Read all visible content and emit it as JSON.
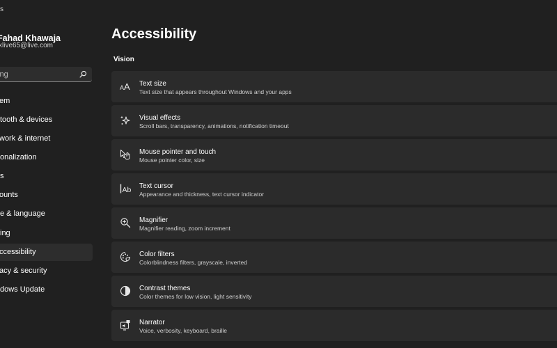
{
  "window": {
    "title_fragment": "s"
  },
  "profile": {
    "name": "Fahad Khawaja",
    "email": "xlive65@live.com"
  },
  "search": {
    "value": "ting"
  },
  "sidebar": {
    "items": [
      {
        "label": "em"
      },
      {
        "label": "tooth & devices"
      },
      {
        "label": "work & internet"
      },
      {
        "label": "onalization"
      },
      {
        "label": "s"
      },
      {
        "label": "ounts"
      },
      {
        "label": "e & language"
      },
      {
        "label": "ing"
      },
      {
        "label": "ccessibility",
        "selected": true
      },
      {
        "label": "acy & security"
      },
      {
        "label": "dows Update"
      }
    ]
  },
  "main": {
    "title": "Accessibility",
    "section": "Vision",
    "cards": [
      {
        "title": "Text size",
        "desc": "Text size that appears throughout Windows and your apps",
        "icon": "text-size-icon"
      },
      {
        "title": "Visual effects",
        "desc": "Scroll bars, transparency, animations, notification timeout",
        "icon": "sparkle-icon"
      },
      {
        "title": "Mouse pointer and touch",
        "desc": "Mouse pointer color, size",
        "icon": "mouse-pointer-icon"
      },
      {
        "title": "Text cursor",
        "desc": "Appearance and thickness, text cursor indicator",
        "icon": "text-cursor-icon"
      },
      {
        "title": "Magnifier",
        "desc": "Magnifier reading, zoom increment",
        "icon": "magnifier-icon"
      },
      {
        "title": "Color filters",
        "desc": "Colorblindness filters, grayscale, inverted",
        "icon": "color-filters-icon"
      },
      {
        "title": "Contrast themes",
        "desc": "Color themes for low vision, light sensitivity",
        "icon": "contrast-icon"
      },
      {
        "title": "Narrator",
        "desc": "Voice, verbosity, keyboard, braille",
        "icon": "narrator-icon"
      }
    ]
  },
  "colors": {
    "background": "#202020",
    "card": "#2b2b2b",
    "selected": "#2d2d2d",
    "text": "#ffffff",
    "secondary_text": "#cfcfcf"
  }
}
